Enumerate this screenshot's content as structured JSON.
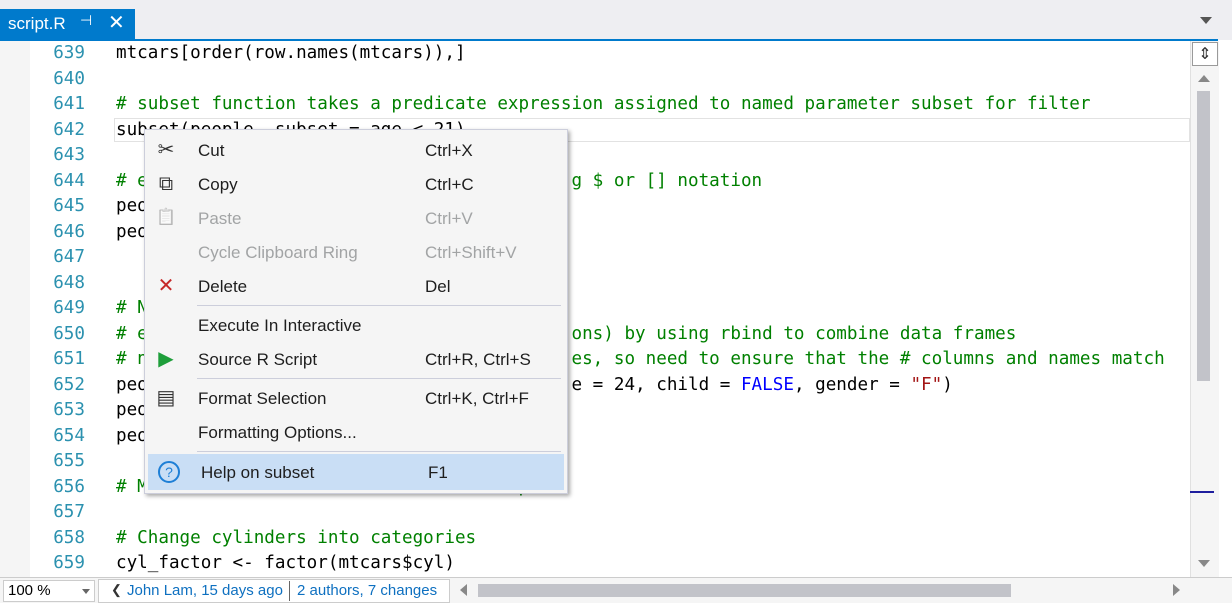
{
  "tab": {
    "title": "script.R",
    "pin": "⊣",
    "close": "✕"
  },
  "editor": {
    "lines": [
      {
        "n": "639",
        "segs": [
          {
            "t": "mtcars[order(row.names(mtcars)),]",
            "c": "p"
          }
        ]
      },
      {
        "n": "640",
        "segs": []
      },
      {
        "n": "641",
        "segs": [
          {
            "t": "# subset function takes a predicate expression assigned to named parameter subset for filter",
            "c": "cm"
          }
        ]
      },
      {
        "n": "642",
        "segs": [
          {
            "t": "subset(people, subset = age < 21)",
            "c": "p"
          }
        ]
      },
      {
        "n": "643",
        "segs": []
      },
      {
        "n": "644",
        "segs": [
          {
            "t": "# e",
            "c": "cm"
          },
          {
            "t": "                                        ",
            "c": "p"
          },
          {
            "t": "g $ or [] notation",
            "c": "cm"
          }
        ]
      },
      {
        "n": "645",
        "segs": [
          {
            "t": "peo",
            "c": "p"
          }
        ]
      },
      {
        "n": "646",
        "segs": [
          {
            "t": "peo",
            "c": "p"
          }
        ]
      },
      {
        "n": "647",
        "segs": []
      },
      {
        "n": "648",
        "segs": []
      },
      {
        "n": "649",
        "segs": [
          {
            "t": "# N",
            "c": "cm"
          }
        ]
      },
      {
        "n": "650",
        "segs": [
          {
            "t": "# e",
            "c": "cm"
          },
          {
            "t": "                                        ",
            "c": "p"
          },
          {
            "t": "ons) by using rbind to combine data frames",
            "c": "cm"
          }
        ]
      },
      {
        "n": "651",
        "segs": [
          {
            "t": "# n",
            "c": "cm"
          },
          {
            "t": "                                        ",
            "c": "p"
          },
          {
            "t": "es, so need to ensure that the # columns and names match",
            "c": "cm"
          }
        ]
      },
      {
        "n": "652",
        "segs": [
          {
            "t": "peo",
            "c": "p"
          },
          {
            "t": "                                        ",
            "c": "p"
          },
          {
            "t": "e = 24, child = ",
            "c": "p"
          },
          {
            "t": "FALSE",
            "c": "kw"
          },
          {
            "t": ", gender = ",
            "c": "p"
          },
          {
            "t": "\"F\"",
            "c": "st"
          },
          {
            "t": ")",
            "c": "p"
          }
        ]
      },
      {
        "n": "653",
        "segs": [
          {
            "t": "peo",
            "c": "p"
          }
        ]
      },
      {
        "n": "654",
        "segs": [
          {
            "t": "peo",
            "c": "p"
          }
        ]
      },
      {
        "n": "655",
        "segs": []
      },
      {
        "n": "656",
        "segs": [
          {
            "t": "# M",
            "c": "cm"
          },
          {
            "t": "                                   ",
            "c": "p"
          },
          {
            "t": "p",
            "c": "cm"
          }
        ]
      },
      {
        "n": "657",
        "segs": []
      },
      {
        "n": "658",
        "segs": [
          {
            "t": "# Change cylinders into categories",
            "c": "cm"
          }
        ]
      },
      {
        "n": "659",
        "segs": [
          {
            "t": "cyl_factor <- factor(mtcars$cyl)",
            "c": "p"
          }
        ]
      }
    ]
  },
  "context_menu": {
    "items": [
      {
        "label": "Cut",
        "shortcut": "Ctrl+X",
        "icon": "✂",
        "icon_name": "scissors-icon",
        "disabled": false,
        "name": "menu-item-cut"
      },
      {
        "label": "Copy",
        "shortcut": "Ctrl+C",
        "icon": "⧉",
        "icon_name": "copy-icon",
        "disabled": false,
        "name": "menu-item-copy"
      },
      {
        "label": "Paste",
        "shortcut": "Ctrl+V",
        "icon": "📋",
        "icon_name": "paste-icon",
        "disabled": true,
        "name": "menu-item-paste"
      },
      {
        "label": "Cycle Clipboard Ring",
        "shortcut": "Ctrl+Shift+V",
        "icon": "",
        "icon_name": "",
        "disabled": true,
        "name": "menu-item-cycle-clipboard-ring"
      },
      {
        "label": "Delete",
        "shortcut": "Del",
        "icon": "✕",
        "icon_name": "delete-icon",
        "disabled": false,
        "name": "menu-item-delete"
      },
      {
        "label": "Execute In Interactive",
        "shortcut": "",
        "icon": "",
        "icon_name": "",
        "disabled": false,
        "name": "menu-item-execute-in-interactive"
      },
      {
        "label": "Source R Script",
        "shortcut": "Ctrl+R, Ctrl+S",
        "icon": "▶",
        "icon_name": "play-icon",
        "disabled": false,
        "name": "menu-item-source-r-script"
      },
      {
        "label": "Format Selection",
        "shortcut": "Ctrl+K, Ctrl+F",
        "icon": "▤",
        "icon_name": "format-document-icon",
        "disabled": false,
        "name": "menu-item-format-selection"
      },
      {
        "label": "Formatting Options...",
        "shortcut": "",
        "icon": "",
        "icon_name": "",
        "disabled": false,
        "name": "menu-item-formatting-options"
      },
      {
        "label": "Help on subset",
        "shortcut": "F1",
        "icon": "?",
        "icon_name": "help-icon",
        "disabled": false,
        "name": "menu-item-help-on-subset"
      }
    ]
  },
  "status": {
    "zoom": "100 %",
    "blame_author": "John Lam, 15 days ago",
    "blame_changes": "2 authors, 7 changes",
    "chevron": "❮"
  },
  "colors": {
    "accent": "#007acc",
    "comment": "#008000",
    "keyword": "#0000ff",
    "string": "#a31515",
    "line_number": "#2b91af",
    "delete_icon": "#c62828",
    "play_icon": "#1e9e3a",
    "help_icon": "#1e7fd6",
    "highlight": "#c9def5"
  }
}
